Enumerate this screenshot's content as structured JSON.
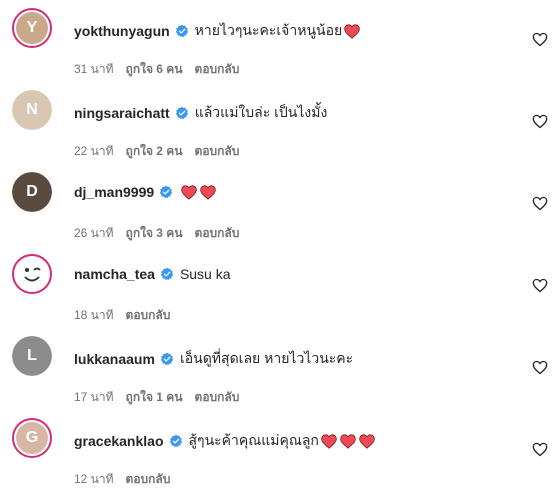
{
  "comments": [
    {
      "username": "yokthunyagun",
      "text": "หายไวๆนะคะเจ้าหนูน้อย",
      "hearts": 1,
      "time": "31 นาที",
      "likes": "ถูกใจ 6 คน",
      "reply": "ตอบกลับ",
      "ring": true,
      "avatar_color": "#caa98b",
      "avatar_initial": "Y"
    },
    {
      "username": "ningsaraichatt",
      "text": "แล้วแม่ใบล่ะ เป็นไงมั้ง",
      "hearts": 0,
      "time": "22 นาที",
      "likes": "ถูกใจ 2 คน",
      "reply": "ตอบกลับ",
      "ring": false,
      "avatar_color": "#d9c7b4",
      "avatar_initial": "N"
    },
    {
      "username": "dj_man9999",
      "text": "",
      "hearts": 2,
      "time": "26 นาที",
      "likes": "ถูกใจ 3 คน",
      "reply": "ตอบกลับ",
      "ring": false,
      "avatar_color": "#5a4a3f",
      "avatar_initial": "D"
    },
    {
      "username": "namcha_tea",
      "text": "Susu ka",
      "hearts": 0,
      "time": "18 นาที",
      "likes": "",
      "reply": "ตอบกลับ",
      "ring": true,
      "avatar_color": "smiley",
      "avatar_initial": ""
    },
    {
      "username": "lukkanaaum",
      "text": "เอ็นดูที่สุดเลย หายไวไวนะคะ",
      "hearts": 0,
      "time": "17 นาที",
      "likes": "ถูกใจ 1 คน",
      "reply": "ตอบกลับ",
      "ring": false,
      "avatar_color": "#8c8c8c",
      "avatar_initial": "L"
    },
    {
      "username": "gracekanklao",
      "text": "สู้ๆนะค้าคุณแม่คุณลูก",
      "hearts": 3,
      "time": "12 นาที",
      "likes": "",
      "reply": "ตอบกลับ",
      "ring": true,
      "avatar_color": "#d8b6a4",
      "avatar_initial": "G"
    }
  ],
  "colors": {
    "verified": "#3897f0",
    "heart": "#ed4956",
    "muted": "#737373",
    "ring": "#d62976"
  },
  "icons": {
    "verified": "verified-badge-icon",
    "heart_emoji": "red-heart-emoji-icon",
    "like": "heart-outline-icon"
  }
}
